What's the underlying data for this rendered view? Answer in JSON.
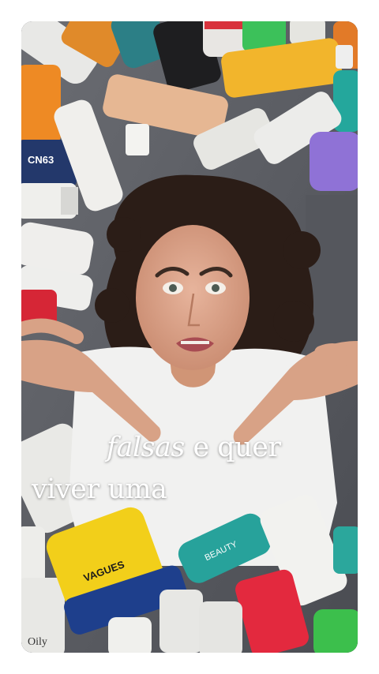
{
  "caption": {
    "line1_italic": "falsas",
    "line1_rest": " e quer",
    "line2": "viver uma"
  },
  "labels": {
    "dark_bottle": "CN63",
    "tube_center": "BEAUTY",
    "yellow_bottle": "VAGUES",
    "corner_jar": "Oily"
  },
  "colors": {
    "background_sheet": "#5e6066",
    "shirt": "#f2f2f2",
    "hair": "#2b1d17",
    "caption_text": "#ffffff"
  }
}
